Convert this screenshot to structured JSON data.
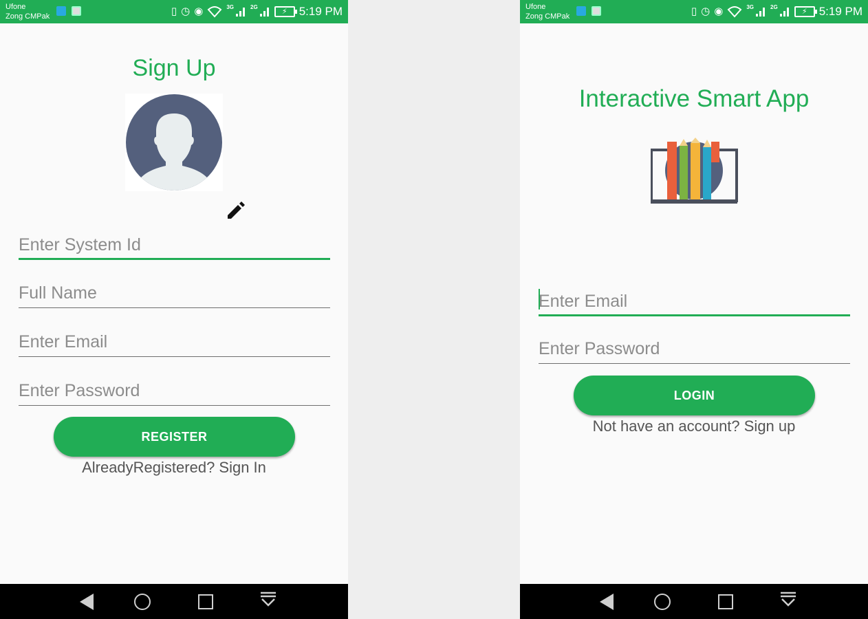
{
  "status_bar": {
    "carrier1": "Ufone",
    "carrier2": "Zong CMPak",
    "net1": "3G",
    "net2": "2G",
    "time": "5:19 PM"
  },
  "signup": {
    "title": "Sign Up",
    "fields": {
      "system_id": "Enter System Id",
      "full_name": "Full Name",
      "email": "Enter Email",
      "password": "Enter Password"
    },
    "register_label": "REGISTER",
    "signin_link": "AlreadyRegistered? Sign In"
  },
  "login": {
    "title": "Interactive Smart App",
    "fields": {
      "email": "Enter Email",
      "password": "Enter Password"
    },
    "login_label": "LOGIN",
    "signup_link": "Not have an account? Sign up"
  },
  "colors": {
    "accent": "#21ad55",
    "avatar_bg": "#54607d"
  },
  "icons": [
    "back-icon",
    "home-icon",
    "recents-icon",
    "notification-pull-icon",
    "pencil-icon",
    "vibrate-icon",
    "alarm-icon",
    "eye-icon",
    "wifi-icon",
    "signal-icon",
    "battery-icon"
  ]
}
